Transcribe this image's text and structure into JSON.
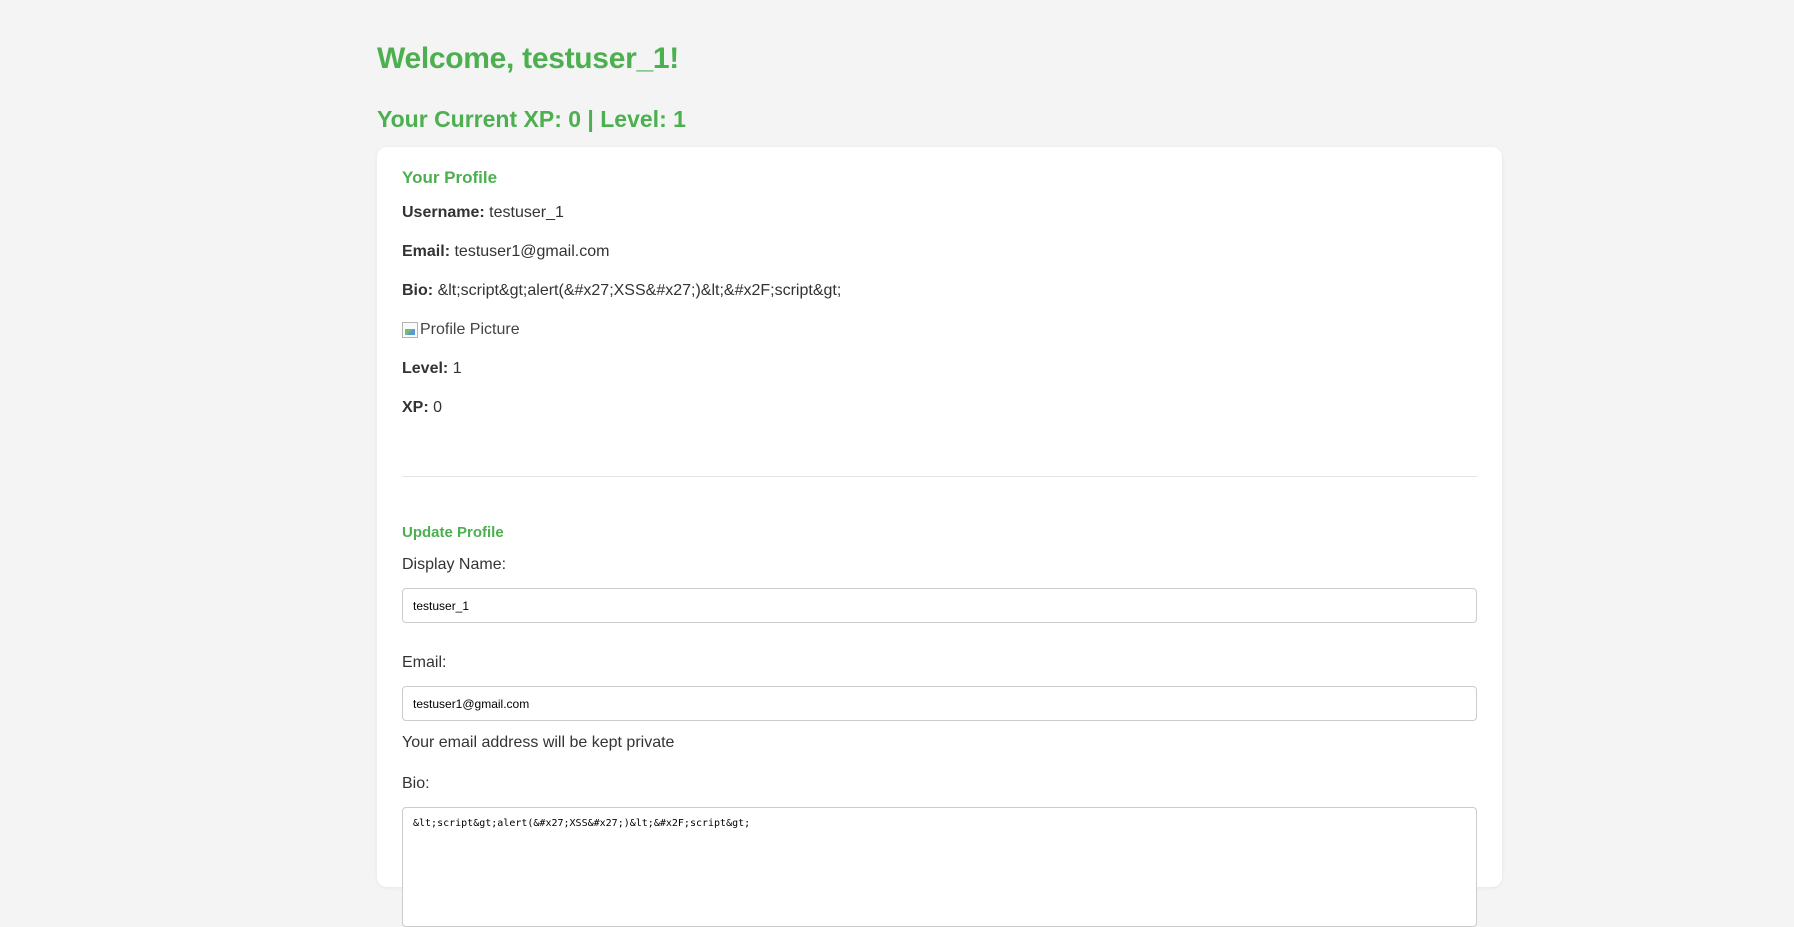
{
  "header": {
    "welcome": "Welcome, testuser_1!",
    "xp_line": "Your Current XP: 0 | Level: 1"
  },
  "profile": {
    "title": "Your Profile",
    "username_label": "Username:",
    "username_value": "testuser_1",
    "email_label": "Email:",
    "email_value": "testuser1@gmail.com",
    "bio_label": "Bio:",
    "bio_value": "&lt;script&gt;alert(&#x27;XSS&#x27;)&lt;&#x2F;script&gt;",
    "picture_alt": "Profile Picture",
    "level_label": "Level:",
    "level_value": "1",
    "xp_label": "XP:",
    "xp_value": "0"
  },
  "update_form": {
    "title": "Update Profile",
    "display_name_label": "Display Name:",
    "display_name_value": "testuser_1",
    "email_label": "Email:",
    "email_value": "testuser1@gmail.com",
    "email_helper": "Your email address will be kept private",
    "bio_label": "Bio:",
    "bio_value": "&lt;script&gt;alert(&#x27;XSS&#x27;)&lt;&#x2F;script&gt;"
  },
  "colors": {
    "accent": "#4caf50",
    "background": "#f4f4f4",
    "card": "#ffffff",
    "text": "#333333"
  },
  "icons": {
    "profile_picture": "broken-image-icon"
  }
}
